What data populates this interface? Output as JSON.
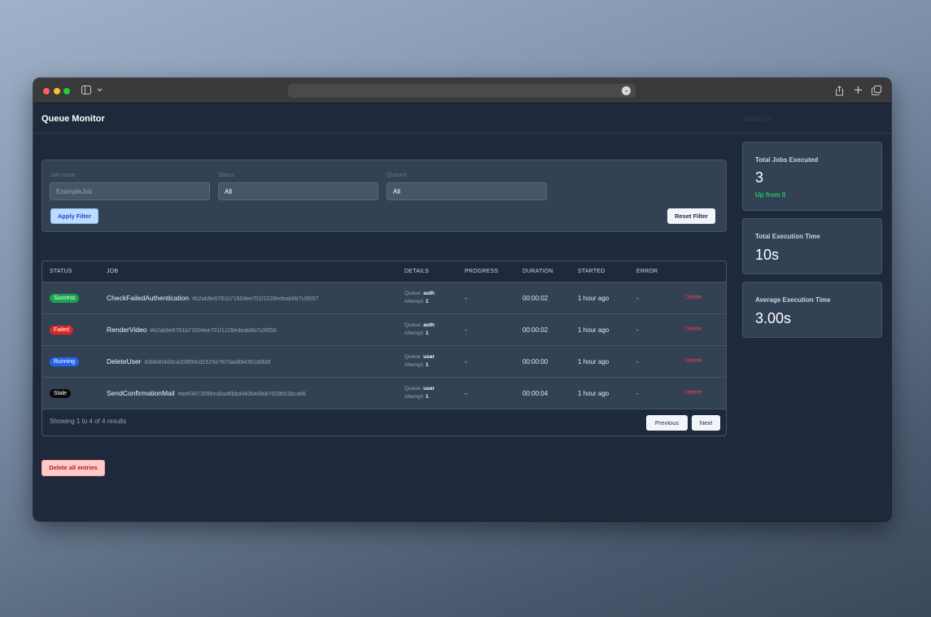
{
  "browser": {
    "more_glyph": "•••",
    "sidebar_icon": "sidebar-icon",
    "chevron_icon": "chevron-down-icon",
    "share_icon": "share-icon",
    "new_tab_icon": "plus-icon",
    "tabs_icon": "tabs-overview-icon"
  },
  "header": {
    "title": "Queue Monitor",
    "stats_heading": "Statistics"
  },
  "filters": {
    "job_name_label": "Job name",
    "job_name_placeholder": "ExampleJob",
    "status_label": "Status",
    "status_value": "All",
    "queues_label": "Queues",
    "queues_value": "All",
    "apply_label": "Apply Filter",
    "reset_label": "Reset Filter"
  },
  "table": {
    "columns": [
      "STATUS",
      "JOB",
      "DETAILS",
      "PROGRESS",
      "DURATION",
      "STARTED",
      "ERROR"
    ],
    "queue_prefix": "Queue:",
    "attempt_prefix": "Attempt:",
    "rows": [
      {
        "status": "Success",
        "status_color": "#16a34a",
        "job": "CheckFailedAuthentication",
        "hash": "#b2ab8e6781b71604ee701f1228edeab6b7c0f057",
        "queue": "auth",
        "attempt": "1",
        "progress": "-",
        "duration": "00:00:02",
        "started": "1 hour ago",
        "error": "-",
        "action": "Delete"
      },
      {
        "status": "Failed",
        "status_color": "#dc2626",
        "job": "RenderVideo",
        "hash": "#b2ab8e6781b71604ee701f1228edeab6b7c0f058",
        "queue": "auth",
        "attempt": "1",
        "progress": "-",
        "duration": "00:00:02",
        "started": "1 hour ago",
        "error": "-",
        "action": "Delete"
      },
      {
        "status": "Running",
        "status_color": "#2563eb",
        "job": "DeleteUser",
        "hash": "#3b6404d3ca208f99cd1525e7873ad894361d0b8f",
        "queue": "user",
        "attempt": "1",
        "progress": "-",
        "duration": "00:00:00",
        "started": "1 hour ago",
        "error": "-",
        "action": "Delete"
      },
      {
        "status": "Stale",
        "status_color": "#0b0b0b",
        "job": "SendConfirmationMail",
        "hash": "#ae83473099ea6ad6bbd460b48fa87028b53bca66",
        "queue": "user",
        "attempt": "1",
        "progress": "-",
        "duration": "00:00:04",
        "started": "1 hour ago",
        "error": "-",
        "action": "Delete"
      }
    ],
    "summary": "Showing 1 to 4 of 4 results",
    "prev_label": "Previous",
    "next_label": "Next"
  },
  "delete_all_label": "Delete all entries",
  "stats": [
    {
      "label": "Total Jobs Executed",
      "value": "3",
      "sub": "Up from 0"
    },
    {
      "label": "Total Execution Time",
      "value": "10s"
    },
    {
      "label": "Average Execution Time",
      "value": "3.00s"
    }
  ]
}
